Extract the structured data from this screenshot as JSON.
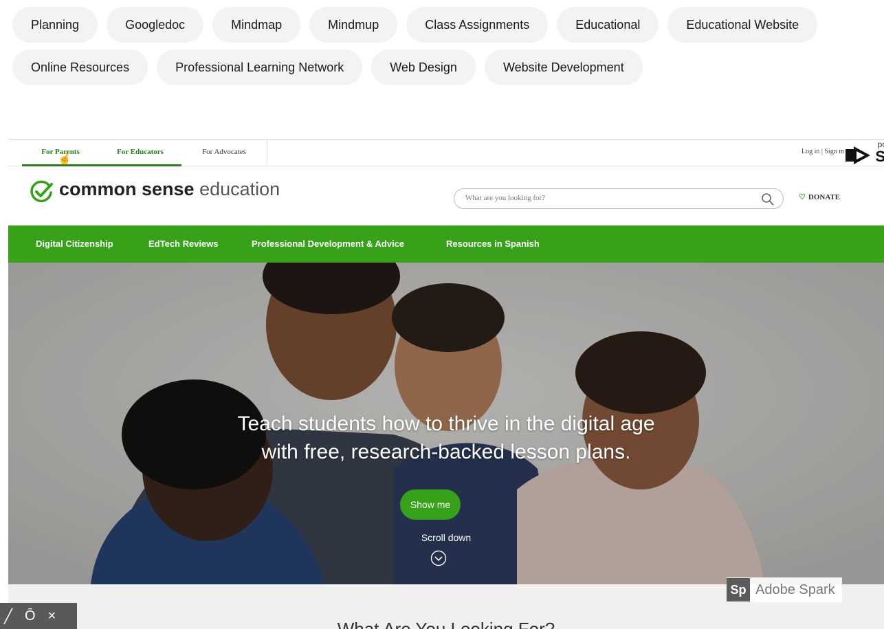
{
  "tags": {
    "row1": [
      "Planning",
      "Googledoc",
      "Mindmap",
      "Mindmup",
      "Class Assignments",
      "Educational",
      "Educational Website"
    ],
    "row2": [
      "Online Resources",
      "Professional Learning Network",
      "Web Design",
      "Website Development"
    ]
  },
  "video": {
    "audience_tabs": [
      "For Parents",
      "For Educators",
      "For Advocates"
    ],
    "login_text": "Log in  |  Sign m",
    "spark_corner_text": "po",
    "spark_corner_letter": "S",
    "logo": {
      "bold": "common sense",
      "light": "education"
    },
    "search_placeholder": "What are you looking for?",
    "donate_label": "DONATE",
    "nav": [
      "Digital Citizenship",
      "EdTech Reviews",
      "Professional Development & Advice",
      "Resources in Spanish"
    ],
    "headline_line1": "Teach students how to thrive in the digital age",
    "headline_line2": "with free, research-backed lesson plans.",
    "cta_label": "Show me",
    "scroll_label": "Scroll down",
    "section_title": "What Are You Looking For?",
    "watermark": {
      "badge": "Sp",
      "text": "Adobe Spark"
    },
    "colors": {
      "brand_green": "#37a219",
      "tab_green": "#2b7f1f"
    }
  },
  "controls": {
    "timer_icon": "Ō",
    "close_icon": "×"
  }
}
